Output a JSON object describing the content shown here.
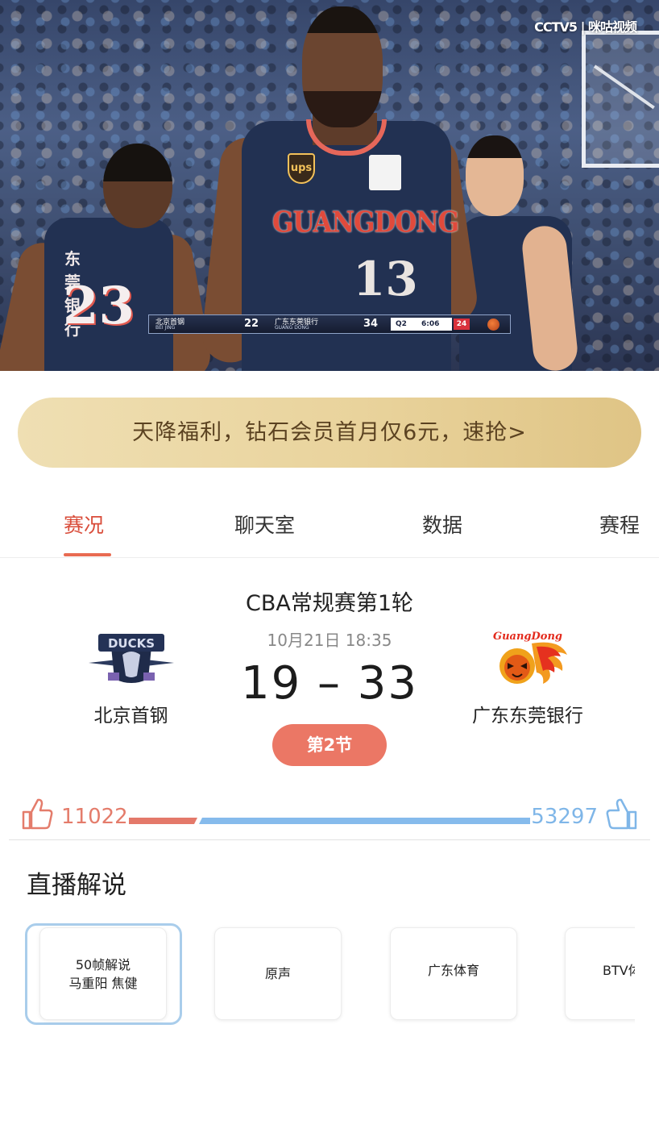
{
  "video": {
    "broadcaster_logo": "CCTV5 | 咪咕视频",
    "scorebug": {
      "home_name": "北京首钢",
      "home_name_en": "BEI JING",
      "home_score": "22",
      "away_name": "广东东莞银行",
      "away_name_en": "GUANG DONG",
      "away_score": "34",
      "quarter": "Q2",
      "clock": "6:06",
      "shot_clock": "24"
    },
    "jersey_text_team": "GUANGDONG",
    "jersey_number_main": "13",
    "jersey_number_left": "23",
    "jersey_sponsor_left": "东莞银行",
    "jersey_sponsor_ups": "ups"
  },
  "promo": {
    "text": "天降福利，钻石会员首月仅6元，速抢>"
  },
  "tabs": [
    {
      "label": "赛况",
      "active": true
    },
    {
      "label": "聊天室",
      "active": false
    },
    {
      "label": "数据",
      "active": false
    },
    {
      "label": "赛程",
      "active": false
    }
  ],
  "match": {
    "league_round": "CBA常规赛第1轮",
    "datetime": "10月21日 18:35",
    "score": "19 – 33",
    "period": "第2节",
    "home": {
      "name": "北京首钢",
      "logo_icon": "beijing-ducks-logo",
      "logo_text": "DUCKS"
    },
    "away": {
      "name": "广东东莞银行",
      "logo_icon": "guangdong-tigers-logo",
      "logo_text": "GuangDong"
    }
  },
  "likes": {
    "home_count": "11022",
    "away_count": "53297",
    "home_color": "#e4796a",
    "away_color": "#86bbec"
  },
  "commentary": {
    "title": "直播解说",
    "options": [
      {
        "line1": "50帧解说",
        "line2": "马重阳  焦健",
        "selected": true
      },
      {
        "line1": "",
        "line2": "原声",
        "selected": false
      },
      {
        "line1": "",
        "line2": "广东体育",
        "selected": false
      },
      {
        "line1": "",
        "line2": "BTV体",
        "selected": false
      }
    ]
  },
  "colors": {
    "accent": "#d94c3a",
    "tab_indicator": "#e86b52",
    "period_badge": "#eb7765",
    "promo_gold": "#e9d39c"
  }
}
